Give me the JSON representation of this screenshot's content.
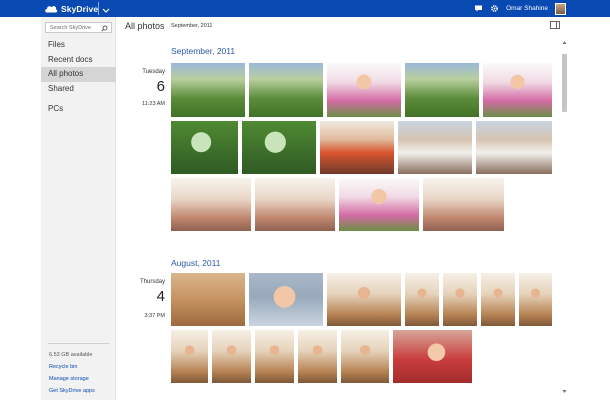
{
  "app": {
    "brand": "SkyDrive",
    "user_name": "Omar Shahine",
    "icons": [
      "skydrive-cloud-icon",
      "chevron-down-icon",
      "message-icon",
      "gear-icon",
      "avatar"
    ],
    "accent": "#094ab2"
  },
  "sidebar": {
    "search_placeholder": "Search SkyDrive",
    "items": [
      {
        "label": "Files",
        "active": false
      },
      {
        "label": "Recent docs",
        "active": false
      },
      {
        "label": "All photos",
        "active": true
      },
      {
        "label": "Shared",
        "active": false
      },
      {
        "label": "PCs",
        "active": false
      }
    ],
    "storage": "6.53 GB available",
    "links": [
      "Recycle bin",
      "Manage storage",
      "Get SkyDrive apps"
    ]
  },
  "main": {
    "title": "All photos",
    "subtitle": "September, 2011",
    "groups": [
      {
        "month": "September, 2011",
        "day_name": "Tuesday",
        "day_num": "6",
        "time": "11:23 AM"
      },
      {
        "month": "August, 2011",
        "day_name": "Thursday",
        "day_num": "4",
        "time": "3:37 PM"
      }
    ]
  }
}
